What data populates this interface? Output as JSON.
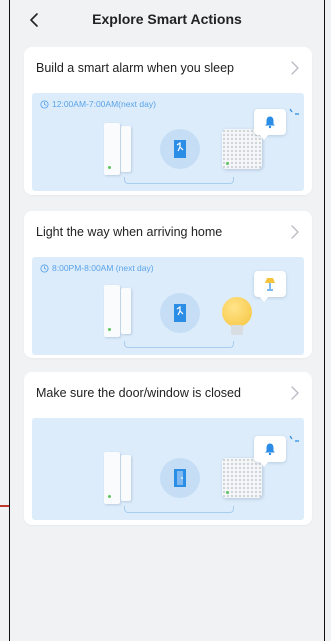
{
  "header": {
    "title": "Explore Smart Actions"
  },
  "cards": [
    {
      "title": "Build a smart alarm when you sleep",
      "time": "12:00AM-7:00AM(next day)"
    },
    {
      "title": "Light the way when arriving home",
      "time": "8:00PM-8:00AM (next day)"
    },
    {
      "title": "Make sure the door/window is closed"
    }
  ],
  "colors": {
    "accent": "#2b8de6",
    "illustration_bg": "#dcecfb",
    "page_bg": "#f1f2f4"
  },
  "icons": {
    "back": "chevron-left-icon",
    "chevron": "chevron-right-icon",
    "clock": "clock-icon",
    "door": "door-icon",
    "bell": "bell-icon",
    "bulb": "light-bulb-icon",
    "lamp": "lamp-icon"
  }
}
